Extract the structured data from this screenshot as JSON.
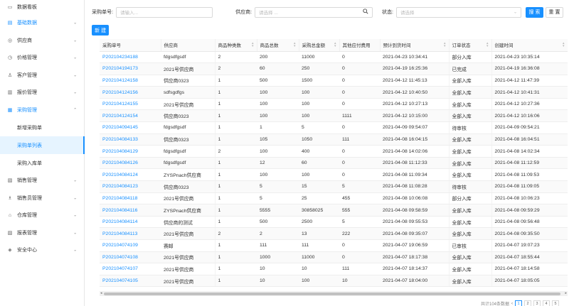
{
  "sidebar": {
    "items": [
      {
        "label": "数据看板",
        "icon": "monitor-icon",
        "chevron": ""
      },
      {
        "label": "基础数据",
        "icon": "document-icon",
        "chevron": "⌄",
        "active": true
      },
      {
        "label": "供应商",
        "icon": "supplier-icon",
        "chevron": "⌄"
      },
      {
        "label": "价格管理",
        "icon": "price-icon",
        "chevron": "⌄"
      },
      {
        "label": "客户管理",
        "icon": "user-icon",
        "chevron": "⌄"
      },
      {
        "label": "报价管理",
        "icon": "quote-icon",
        "chevron": "⌄"
      },
      {
        "label": "采购管理",
        "icon": "purchase-icon",
        "chevron": "⌃",
        "active": true
      }
    ],
    "sub_items": [
      "新增采购单",
      "采购单列表",
      "采购入库单"
    ],
    "items_after": [
      {
        "label": "销售管理",
        "icon": "sales-icon",
        "chevron": "⌄"
      },
      {
        "label": "销售员管理",
        "icon": "salesman-icon",
        "chevron": "⌄"
      },
      {
        "label": "仓库管理",
        "icon": "warehouse-icon",
        "chevron": "⌄"
      },
      {
        "label": "报表管理",
        "icon": "report-icon",
        "chevron": "⌄"
      },
      {
        "label": "安全中心",
        "icon": "shield-icon",
        "chevron": "⌄"
      }
    ]
  },
  "filter": {
    "order_label": "采购单号:",
    "order_placeholder": "请输入...",
    "supplier_label": "供应商:",
    "supplier_placeholder": "请选择 ...",
    "status_label": "状态:",
    "status_placeholder": "请选择",
    "search_label": "搜 索",
    "reset_label": "重 置"
  },
  "new_label": "新 建",
  "table": {
    "columns": [
      "采购单号",
      "供应商",
      "商品种类数",
      "商品总数",
      "采购总金额",
      "其他应付费用",
      "预计到货时间",
      "订单状态",
      "创建时间"
    ],
    "rows": [
      [
        "P202104234188",
        "fdgsdfgsdf",
        "2",
        "200",
        "11000",
        "0",
        "2021-04-23 10:34:41",
        "部分入库",
        "2021-04-23 10:35:14"
      ],
      [
        "P202104194173",
        "2021号供应商",
        "2",
        "60",
        "250",
        "0",
        "2021-04-19 16:25:36",
        "已完成",
        "2021-04-19 16:36:08"
      ],
      [
        "P202104124158",
        "供应商0323",
        "1",
        "500",
        "1500",
        "0",
        "2021-04-12 11:45:13",
        "全部入库",
        "2021-04-12 11:47:39"
      ],
      [
        "P202104124156",
        "sdfsgdfgs",
        "1",
        "100",
        "100",
        "0",
        "2021-04-12 10:40:50",
        "全部入库",
        "2021-04-12 10:41:31"
      ],
      [
        "P202104124155",
        "2021号供应商",
        "1",
        "100",
        "100",
        "0",
        "2021-04-12 10:27:13",
        "全部入库",
        "2021-04-12 10:27:36"
      ],
      [
        "P202104124154",
        "供应商0323",
        "1",
        "100",
        "100",
        "1111",
        "2021-04-12 10:15:00",
        "全部入库",
        "2021-04-12 10:16:06"
      ],
      [
        "P202104094145",
        "fdgsdfgsdf",
        "1",
        "1",
        "5",
        "0",
        "2021-04-09 09:54:07",
        "待审核",
        "2021-04-09 09:54:21"
      ],
      [
        "P202104084133",
        "供应商0323",
        "1",
        "105",
        "1050",
        "111",
        "2021-04-08 16:04:15",
        "全部入库",
        "2021-04-08 16:04:51"
      ],
      [
        "P202104084129",
        "fdgsdfgsdf",
        "2",
        "100",
        "400",
        "0",
        "2021-04-08 14:02:06",
        "全部入库",
        "2021-04-08 14:02:34"
      ],
      [
        "P202104084126",
        "fdgsdfgsdf",
        "1",
        "12",
        "60",
        "0",
        "2021-04-08 11:12:33",
        "全部入库",
        "2021-04-08 11:12:59"
      ],
      [
        "P202104084124",
        "ZYSPnach供应商",
        "1",
        "100",
        "100",
        "0",
        "2021-04-08 11:09:34",
        "全部入库",
        "2021-04-08 11:09:53"
      ],
      [
        "P202104084123",
        "供应商0323",
        "1",
        "5",
        "15",
        "5",
        "2021-04-08 11:08:28",
        "待审核",
        "2021-04-08 11:09:05"
      ],
      [
        "P202104084118",
        "2021号供应商",
        "1",
        "5",
        "25",
        "455",
        "2021-04-08 10:06:08",
        "部分入库",
        "2021-04-08 10:06:23"
      ],
      [
        "P202104084116",
        "ZYSPnach供应商",
        "1",
        "5555",
        "30858025",
        "555",
        "2021-04-08 09:58:59",
        "全部入库",
        "2021-04-08 09:59:29"
      ],
      [
        "P202104084114",
        "供应商的测试",
        "1",
        "500",
        "2500",
        "5",
        "2021-04-08 09:55:53",
        "全部入库",
        "2021-04-08 09:56:48"
      ],
      [
        "P202104084113",
        "2021号供应商",
        "2",
        "2",
        "13",
        "222",
        "2021-04-08 09:35:07",
        "全部入库",
        "2021-04-08 09:35:50"
      ],
      [
        "P202104074109",
        "赛邮",
        "1",
        "111",
        "111",
        "0",
        "2021-04-07 19:06:59",
        "已审核",
        "2021-04-07 19:07:23"
      ],
      [
        "P202104074108",
        "2021号供应商",
        "1",
        "1000",
        "11000",
        "0",
        "2021-04-07 18:17:38",
        "全部入库",
        "2021-04-07 18:55:44"
      ],
      [
        "P202104074107",
        "2021号供应商",
        "1",
        "10",
        "10",
        "111",
        "2021-04-07 18:14:37",
        "全部入库",
        "2021-04-07 18:14:58"
      ],
      [
        "P202104074105",
        "2021号供应商",
        "1",
        "10",
        "100",
        "10",
        "2021-04-07 18:04:00",
        "全部入库",
        "2021-04-07 18:05:05"
      ]
    ]
  },
  "pager": {
    "total": "共计104条数据",
    "pages": [
      "1",
      "2",
      "3",
      "4",
      "5"
    ],
    "current": "1"
  }
}
